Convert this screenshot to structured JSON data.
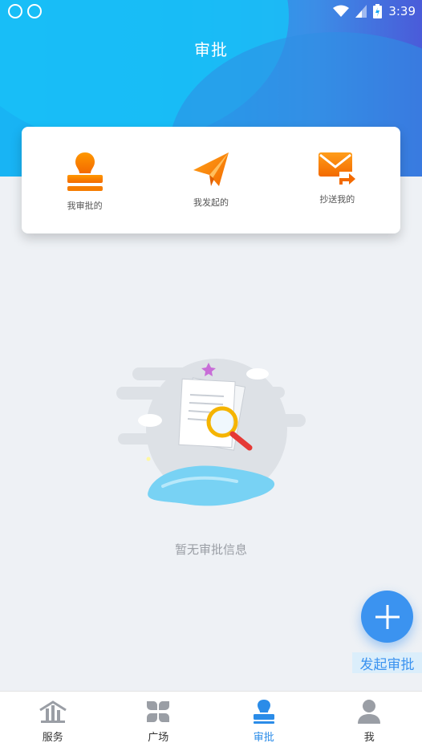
{
  "status_bar": {
    "time": "3:39"
  },
  "header": {
    "title": "审批"
  },
  "quick_actions": [
    {
      "label": "我审批的",
      "icon": "stamp-icon"
    },
    {
      "label": "我发起的",
      "icon": "paper-plane-icon"
    },
    {
      "label": "抄送我的",
      "icon": "mail-forward-icon"
    }
  ],
  "empty_state": {
    "message": "暂无审批信息"
  },
  "fab": {
    "label": "发起审批"
  },
  "tabs": [
    {
      "label": "服务",
      "icon": "building-icon"
    },
    {
      "label": "广场",
      "icon": "clover-icon"
    },
    {
      "label": "审批",
      "icon": "approval-icon"
    },
    {
      "label": "我",
      "icon": "person-icon"
    }
  ],
  "colors": {
    "accent": "#2b8ce8",
    "orange": "#f57c00",
    "fab": "#3b93f0"
  }
}
